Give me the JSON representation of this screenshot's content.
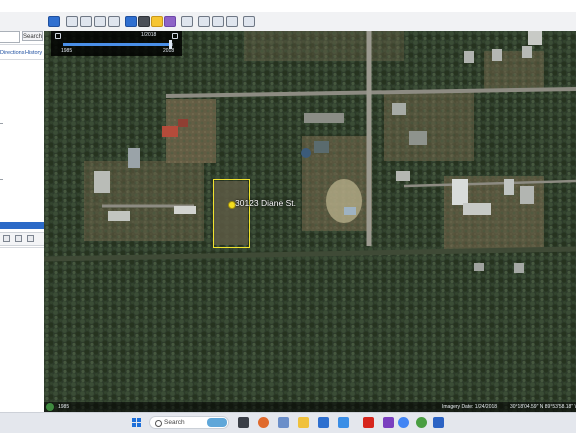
{
  "sidebar": {
    "search_button": "Search",
    "tabs": [
      "Directions",
      "History"
    ]
  },
  "slider": {
    "date": "1/2018",
    "year_start": "1985",
    "year_end": "2018",
    "position": 0.98
  },
  "placemark": {
    "label": "30123 Diane St."
  },
  "status": {
    "year": "1985",
    "imagery_date": "Imagery Date: 1/24/2018",
    "coordinates": "30°18'04.59\" N    89°53'58.18\" W"
  },
  "taskbar": {
    "search_label": "Search"
  },
  "colors": {
    "accent": "#2a69c7",
    "placemark": "#f2e32e",
    "road": "#9c9a90"
  },
  "icons": {
    "toolbar": [
      "sidebar-toggle-icon",
      "placemark-icon",
      "polygon-icon",
      "path-icon",
      "overlay-icon",
      "tour-icon",
      "historical-imagery-icon",
      "sunlight-icon",
      "planets-icon",
      "ruler-icon",
      "email-icon",
      "print-icon",
      "save-image-icon",
      "maps-icon"
    ]
  }
}
